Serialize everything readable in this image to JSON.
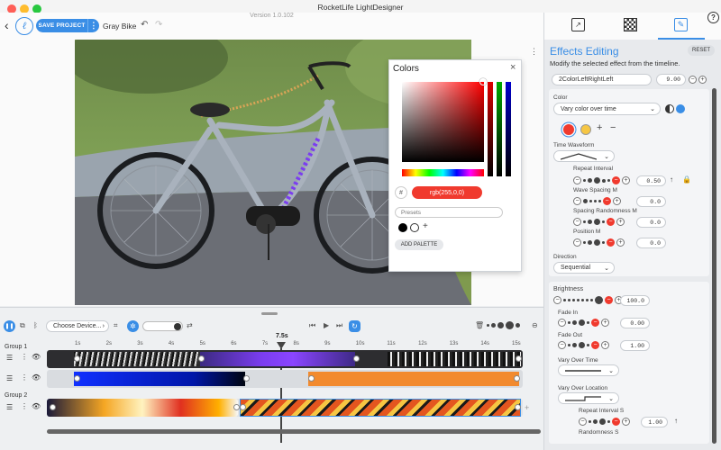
{
  "app": {
    "title": "RocketLife LightDesigner",
    "version": "Version 1.0.102"
  },
  "toolbar": {
    "save_label": "SAVE PROJECT",
    "project_name": "Gray Bike"
  },
  "colors_popup": {
    "title": "Colors",
    "hash": "#",
    "rgb_value": "rgb(255,0,0)",
    "presets_placeholder": "Presets",
    "add_palette_label": "ADD PALETTE",
    "plus": "+"
  },
  "timeline": {
    "device_select": "Choose Device...",
    "playhead_label": "7.5s",
    "ticks": [
      "1s",
      "2s",
      "3s",
      "4s",
      "5s",
      "6s",
      "7s",
      "8s",
      "9s",
      "10s",
      "11s",
      "12s",
      "13s",
      "14s",
      "15s"
    ],
    "group1_label": "Group 1",
    "group2_label": "Group 2"
  },
  "panel": {
    "title": "Effects Editing",
    "reset_label": "RESET",
    "subtitle": "Modify the selected effect from the timeline.",
    "effect_name": "2ColorLeftRightLeft",
    "effect_value": "9.00",
    "color_label": "Color",
    "color_mode": "Vary color over time",
    "time_waveform_label": "Time Waveform",
    "repeat_interval_label": "Repeat Interval",
    "repeat_interval_value": "0.50",
    "wave_spacing_label": "Wave Spacing M",
    "wave_spacing_value": "0.0",
    "spacing_randomness_label": "Spacing Randomness M",
    "spacing_randomness_value": "0.0",
    "position_label": "Position M",
    "position_value": "0.0",
    "direction_label": "Direction",
    "direction_value": "Sequential",
    "brightness_label": "Brightness",
    "brightness_value": "100.0",
    "fade_in_label": "Fade In",
    "fade_in_value": "0.00",
    "fade_out_label": "Fade Out",
    "fade_out_value": "1.00",
    "vary_over_time_label": "Vary Over Time",
    "vary_over_location_label": "Vary Over Location",
    "repeat_interval_s_label": "Repeat Interval S",
    "repeat_interval_s_value": "1.00",
    "randomness_s_label": "Randomness S"
  },
  "accent": "#3a8ee6"
}
